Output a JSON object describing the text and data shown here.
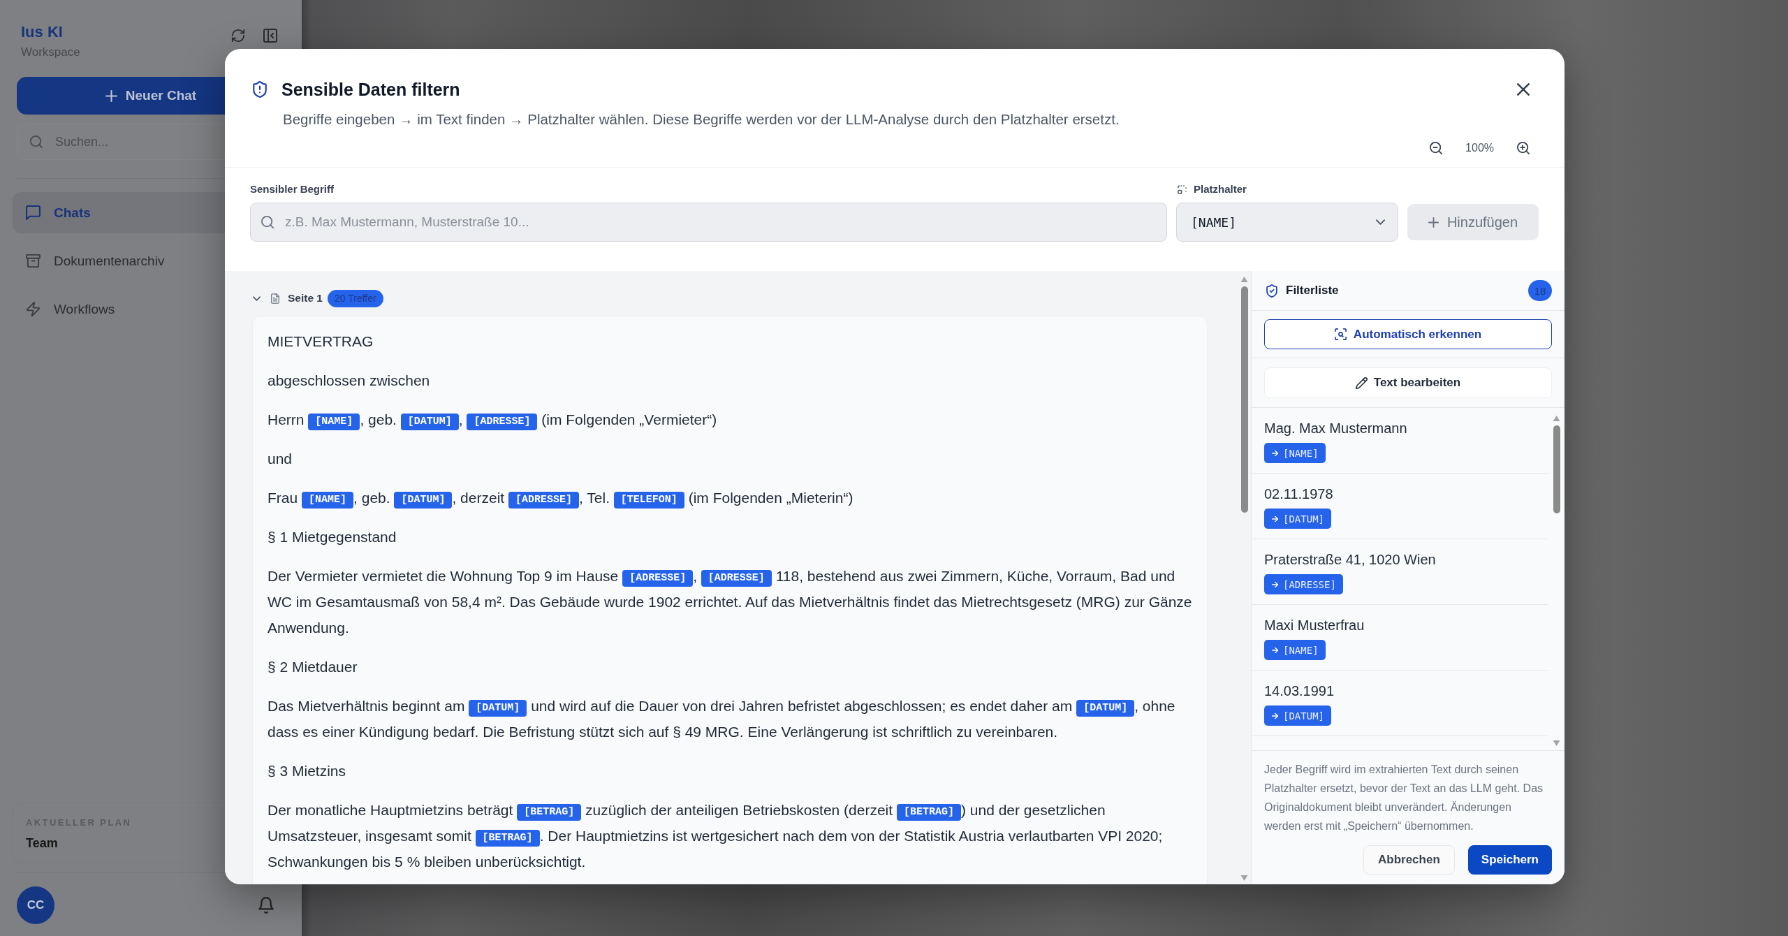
{
  "sidebar": {
    "brand": "Ius KI",
    "workspace": "Workspace",
    "new_chat_button": "Neuer Chat",
    "search": {
      "placeholder": "Suchen..."
    },
    "items": [
      {
        "label": "Chats",
        "selected": true
      },
      {
        "label": "Dokumentenarchiv",
        "selected": false
      },
      {
        "label": "Workflows",
        "selected": false
      }
    ],
    "plan": {
      "label": "AKTUELLER PLAN",
      "value": "Team"
    },
    "avatar": "CC"
  },
  "dialog": {
    "title": "Sensible Daten filtern",
    "subtitle": "Begriffe eingeben → im Text finden → Platzhalter wählen. Diese Begriffe werden vor der LLM-Analyse durch den Platzhalter ersetzt.",
    "zoom_level": "100%",
    "term_field": {
      "label": "Sensibler Begriff",
      "placeholder": "z.B. Max Mustermann, Musterstraße 10..."
    },
    "replacement_field": {
      "label": "Platzhalter",
      "value": "[NAME]"
    },
    "add_button": {
      "label": "Hinzufügen",
      "disabled": true
    },
    "page": {
      "label": "Seite 1",
      "hits": "20 Treffer",
      "expanded": true,
      "paragraphs": [
        [
          {
            "kind": "text",
            "text": "MIETVERTRAG"
          }
        ],
        [
          {
            "kind": "text",
            "text": "abgeschlossen zwischen"
          }
        ],
        [
          {
            "kind": "text",
            "text": "Herrn "
          },
          {
            "kind": "tag",
            "text": "[NAME]"
          },
          {
            "kind": "text",
            "text": ", geb. "
          },
          {
            "kind": "tag",
            "text": "[DATUM]"
          },
          {
            "kind": "text",
            "text": ", "
          },
          {
            "kind": "tag",
            "text": "[ADRESSE]"
          },
          {
            "kind": "text",
            "text": " (im Folgenden „Vermieter“)"
          }
        ],
        [
          {
            "kind": "text",
            "text": "und"
          }
        ],
        [
          {
            "kind": "text",
            "text": "Frau "
          },
          {
            "kind": "tag",
            "text": "[NAME]"
          },
          {
            "kind": "text",
            "text": ", geb. "
          },
          {
            "kind": "tag",
            "text": "[DATUM]"
          },
          {
            "kind": "text",
            "text": ", derzeit "
          },
          {
            "kind": "tag",
            "text": "[ADRESSE]"
          },
          {
            "kind": "text",
            "text": ", Tel. "
          },
          {
            "kind": "tag",
            "text": "[TELEFON]"
          },
          {
            "kind": "text",
            "text": " (im Folgenden „Mieterin“)"
          }
        ],
        [
          {
            "kind": "text",
            "text": "§ 1 Mietgegenstand"
          }
        ],
        [
          {
            "kind": "text",
            "text": "Der Vermieter vermietet die Wohnung Top 9 im Hause "
          },
          {
            "kind": "tag",
            "text": "[ADRESSE]"
          },
          {
            "kind": "text",
            "text": ", "
          },
          {
            "kind": "tag",
            "text": "[ADRESSE]"
          },
          {
            "kind": "text",
            "text": " 118, bestehend aus zwei Zimmern, Küche, Vorraum, Bad und WC im Gesamtausmaß von 58,4 m². Das Gebäude wurde 1902 errichtet. Auf das Mietverhältnis findet das Mietrechtsgesetz (MRG) zur Gänze Anwendung."
          }
        ],
        [
          {
            "kind": "text",
            "text": "§ 2 Mietdauer"
          }
        ],
        [
          {
            "kind": "text",
            "text": "Das Mietverhältnis beginnt am "
          },
          {
            "kind": "tag",
            "text": "[DATUM]"
          },
          {
            "kind": "text",
            "text": " und wird auf die Dauer von drei Jahren befristet abgeschlossen; es endet daher am "
          },
          {
            "kind": "tag",
            "text": "[DATUM]"
          },
          {
            "kind": "text",
            "text": ", ohne dass es einer Kündigung bedarf. Die Befristung stützt sich auf § 49 MRG. Eine Verlängerung ist schriftlich zu vereinbaren."
          }
        ],
        [
          {
            "kind": "text",
            "text": "§ 3 Mietzins"
          }
        ],
        [
          {
            "kind": "text",
            "text": "Der monatliche Hauptmietzins beträgt "
          },
          {
            "kind": "tag",
            "text": "[BETRAG]"
          },
          {
            "kind": "text",
            "text": " zuzüglich der anteiligen Betriebskosten (derzeit "
          },
          {
            "kind": "tag",
            "text": "[BETRAG]"
          },
          {
            "kind": "text",
            "text": ") und der gesetzlichen Umsatzsteuer, insgesamt somit "
          },
          {
            "kind": "tag",
            "text": "[BETRAG]"
          },
          {
            "kind": "text",
            "text": ". Der Hauptmietzins ist wertgesichert nach dem von der Statistik Austria verlautbarten VPI 2020; Schwankungen bis 5 % bleiben unberücksichtigt."
          }
        ]
      ]
    },
    "filter_list": {
      "title": "Filterliste",
      "count": "18",
      "auto_button": "Automatisch erkennen",
      "edit_button": "Text bearbeiten",
      "entries": [
        {
          "term": "Mag. Max Mustermann",
          "replacement": "[NAME]"
        },
        {
          "term": "02.11.1978",
          "replacement": "[DATUM]"
        },
        {
          "term": "Praterstraße 41, 1020 Wien",
          "replacement": "[ADRESSE]"
        },
        {
          "term": "Maxi Musterfrau",
          "replacement": "[NAME]"
        },
        {
          "term": "14.03.1991",
          "replacement": "[DATUM]"
        }
      ],
      "note": "Jeder Begriff wird im extrahierten Text durch seinen Platzhalter ersetzt, bevor der Text an das LLM geht. Das Originaldokument bleibt unverändert. Änderungen werden erst mit „Speichern“ übernommen.",
      "buttons": [
        {
          "label": "Abbrechen",
          "kind": "secondary"
        },
        {
          "label": "Speichern",
          "kind": "primary"
        }
      ]
    }
  }
}
